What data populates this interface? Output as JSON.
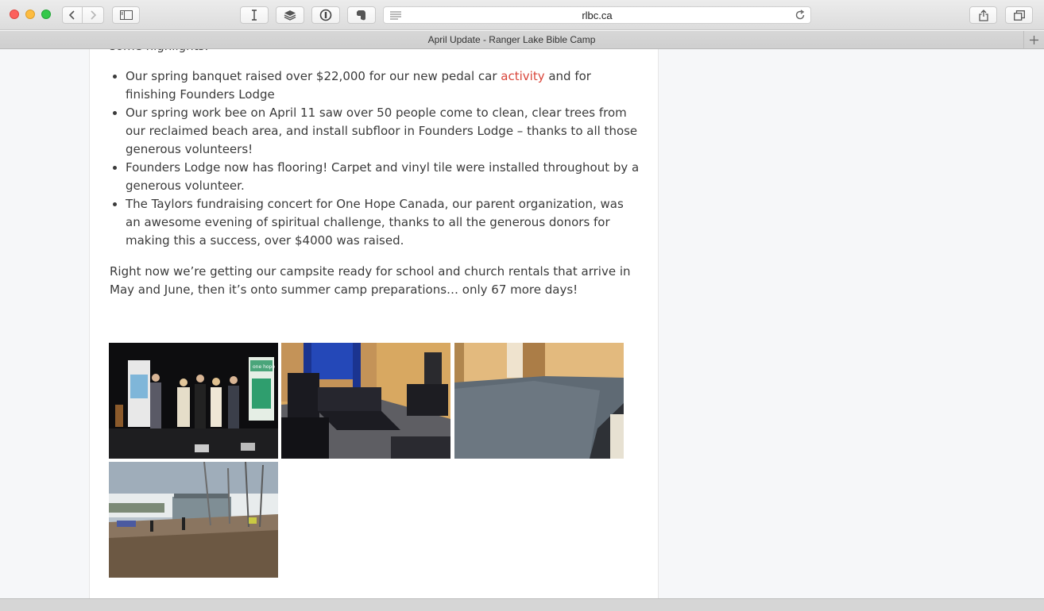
{
  "browser": {
    "url": "rlbc.ca",
    "tab_title": "April Update - Ranger Lake Bible Camp"
  },
  "article": {
    "cut_line": "some highlights:",
    "bullet1_a": "Our spring banquet raised over $22,000 for our new pedal car ",
    "bullet1_link": "activity",
    "bullet1_b": " and for finishing Founders Lodge",
    "bullet2": "Our spring work bee on April 11 saw over 50 people come to clean, clear trees from our reclaimed beach area, and install subfloor in Founders Lodge – thanks to all those generous volunteers!",
    "bullet3": "Founders Lodge now has flooring! Carpet and vinyl tile were installed throughout by a generous volunteer.",
    "bullet4": "The Taylors fundraising concert for One Hope Canada, our parent organization, was an awesome evening of spiritual challenge, thanks to all the generous donors for making this a success, over $4000 was raised.",
    "paragraph": "Right now we’re getting our campsite ready for school and church rentals that arrive in May and June, then it’s onto summer camp preparations… only 67 more days!"
  },
  "gallery": {
    "concert_banner_text": "one hope"
  },
  "colors": {
    "link": "#d9453a",
    "text": "#3a3a3a"
  }
}
